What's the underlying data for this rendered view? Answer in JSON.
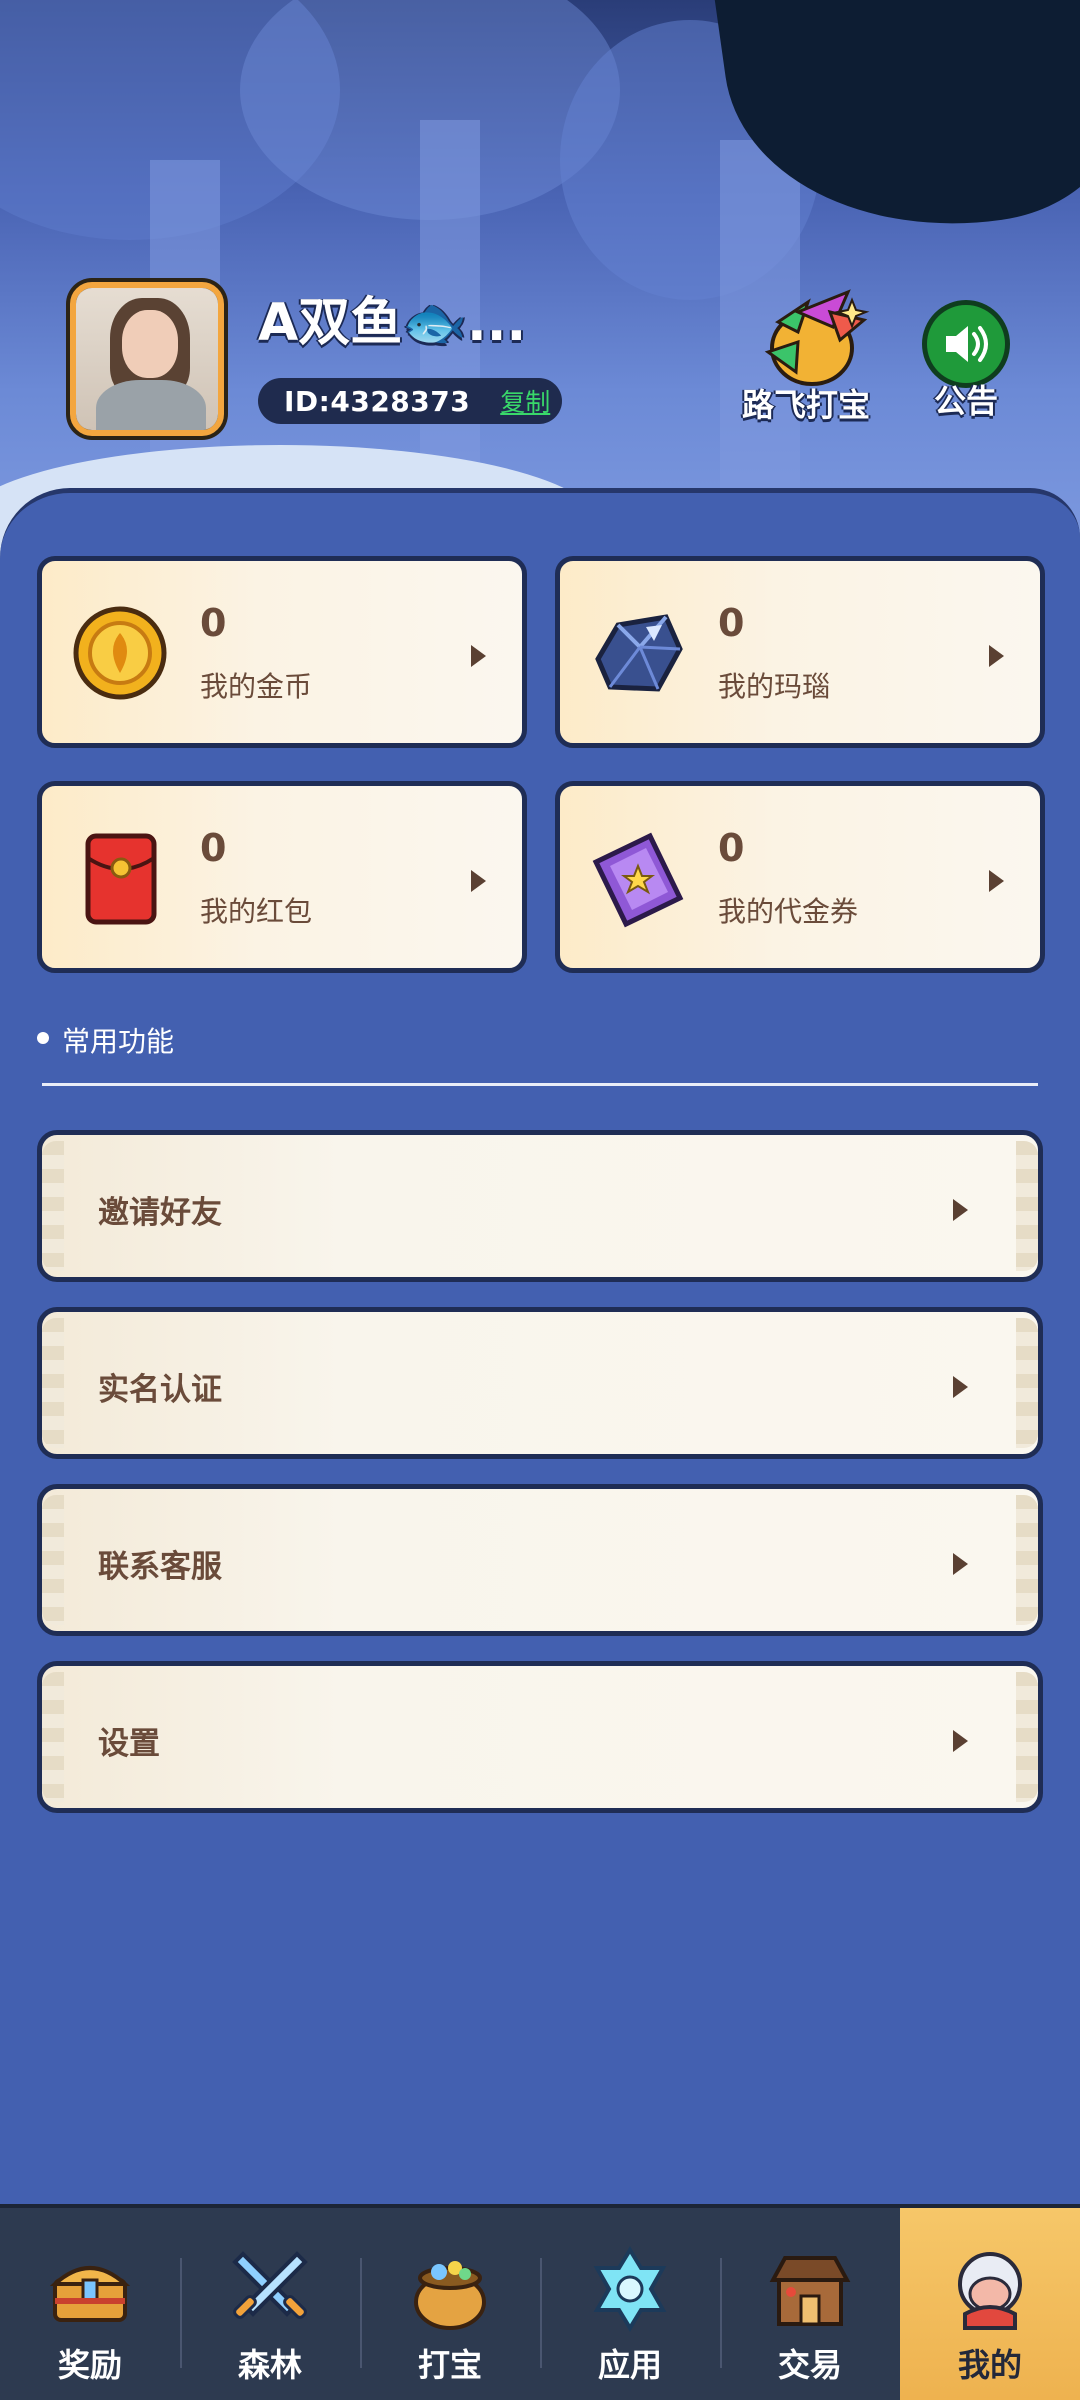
{
  "profile": {
    "username": "A双鱼🐟...",
    "id_text": "ID:4328373",
    "copy_label": "复制"
  },
  "header_actions": {
    "luffy_label": "路飞打宝",
    "notice_label": "公告"
  },
  "assets": [
    {
      "icon": "gold-coin-icon",
      "value": "0",
      "label": "我的金币"
    },
    {
      "icon": "agate-gem-icon",
      "value": "0",
      "label": "我的玛瑙"
    },
    {
      "icon": "red-packet-icon",
      "value": "0",
      "label": "我的红包"
    },
    {
      "icon": "voucher-ticket-icon",
      "value": "0",
      "label": "我的代金券"
    }
  ],
  "section": {
    "title": "常用功能"
  },
  "menu": [
    {
      "label": "邀请好友"
    },
    {
      "label": "实名认证"
    },
    {
      "label": "联系客服"
    },
    {
      "label": "设置"
    }
  ],
  "bottom_nav": [
    {
      "label": "奖励",
      "icon": "treasure-chest-icon",
      "active": false
    },
    {
      "label": "森林",
      "icon": "crossed-swords-icon",
      "active": false
    },
    {
      "label": "打宝",
      "icon": "treasure-pot-icon",
      "active": false
    },
    {
      "label": "应用",
      "icon": "snowflake-icon",
      "active": false
    },
    {
      "label": "交易",
      "icon": "shop-icon",
      "active": false
    },
    {
      "label": "我的",
      "icon": "profile-character-icon",
      "active": true
    }
  ],
  "colors": {
    "panel_blue": "#4360b0",
    "card_border": "#1f2d55",
    "copy_green": "#39d86a",
    "nav_active": "#f0b652",
    "text_brown": "#6a4b3a"
  }
}
